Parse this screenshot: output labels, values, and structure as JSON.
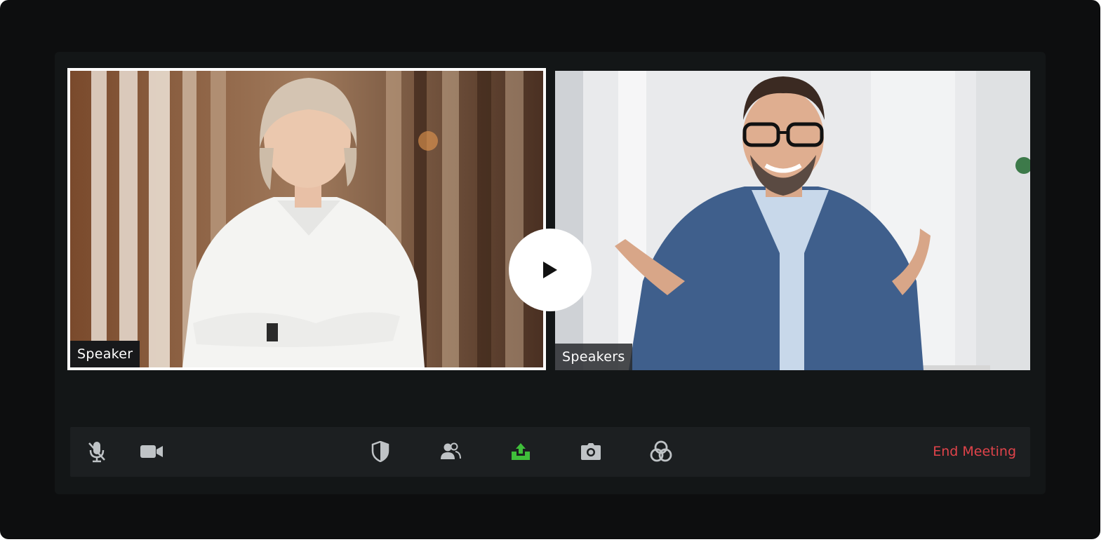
{
  "participants": [
    {
      "name": "Speaker",
      "active": true
    },
    {
      "name": "Speakers",
      "active": false
    }
  ],
  "controls": {
    "play": {
      "icon": "play-icon"
    },
    "mute": {
      "icon": "mic-off-icon"
    },
    "video": {
      "icon": "video-camera-icon"
    },
    "security": {
      "icon": "shield-icon"
    },
    "participants": {
      "icon": "participants-icon"
    },
    "share": {
      "icon": "share-screen-icon",
      "color": "#3fbf3a"
    },
    "snapshot": {
      "icon": "camera-icon"
    },
    "apps": {
      "icon": "apps-rings-icon"
    },
    "end_label": "End Meeting",
    "end_color": "#e0434a"
  },
  "colors": {
    "background": "#0d0e0f",
    "panel": "#131617",
    "toolbar": "#1c1f21",
    "icon": "#bfc3c6",
    "active_border": "#ffffff"
  }
}
